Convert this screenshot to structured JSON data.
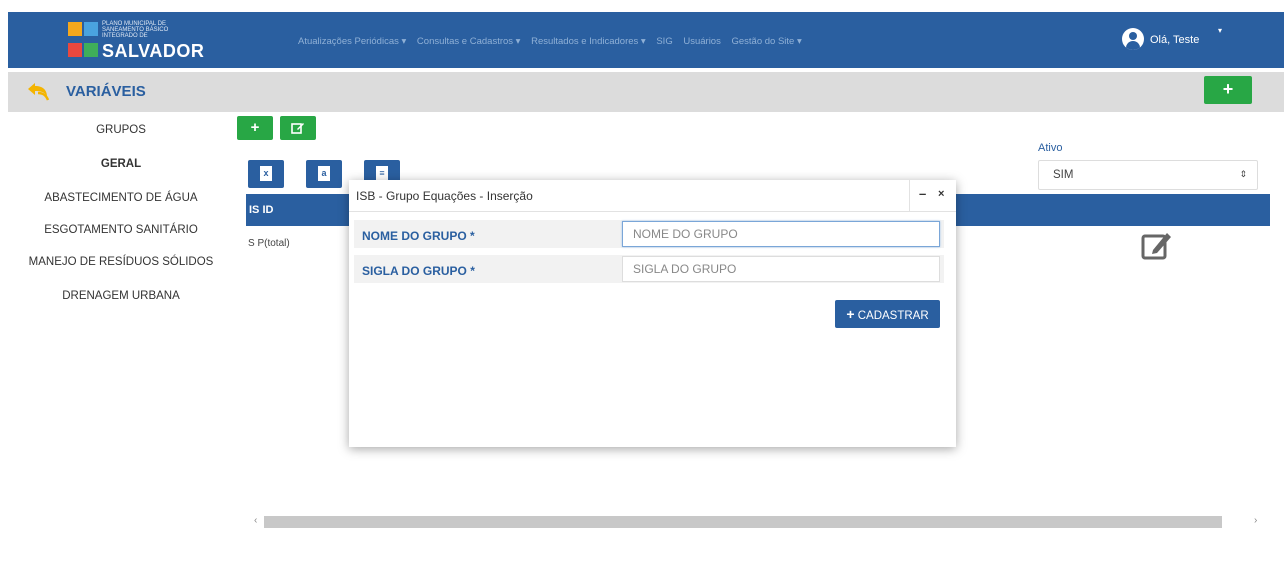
{
  "header": {
    "logo_small": "PLANO MUNICIPAL DE SANEAMENTO BÁSICO INTEGRADO DE",
    "logo_big": "SALVADOR",
    "menu": [
      "Atualizações Periódicas ▾",
      "Consultas e Cadastros ▾",
      "Resultados e Indicadores ▾",
      "SIG",
      "Usuários",
      "Gestão do Site ▾"
    ],
    "user_greeting": "Olá, Teste",
    "brand_color": "#2a5fa0"
  },
  "pagebar": {
    "title": "VARIÁVEIS",
    "add_label": "+"
  },
  "sidebar": {
    "items": [
      "GRUPOS",
      "GERAL",
      "ABASTECIMENTO DE ÁGUA",
      "ESGOTAMENTO SANITÁRIO",
      "MANEJO DE RESÍDUOS SÓLIDOS",
      "DRENAGEM URBANA"
    ]
  },
  "toolbar": {
    "add_label": "+"
  },
  "table": {
    "header": "IS ID",
    "rows": [
      {
        "col1": "S  P(total)"
      }
    ]
  },
  "filter": {
    "label": "Ativo",
    "selected": "SIM"
  },
  "modal": {
    "title": "ISB - Grupo Equações - Inserção",
    "minimize": "–",
    "close": "×",
    "fields": [
      {
        "label": "NOME DO GRUPO *",
        "placeholder": "NOME DO GRUPO",
        "value": ""
      },
      {
        "label": "SIGLA DO GRUPO *",
        "placeholder": "SIGLA DO GRUPO",
        "value": ""
      }
    ],
    "submit_plus": "+",
    "submit_label": "CADASTRAR"
  }
}
